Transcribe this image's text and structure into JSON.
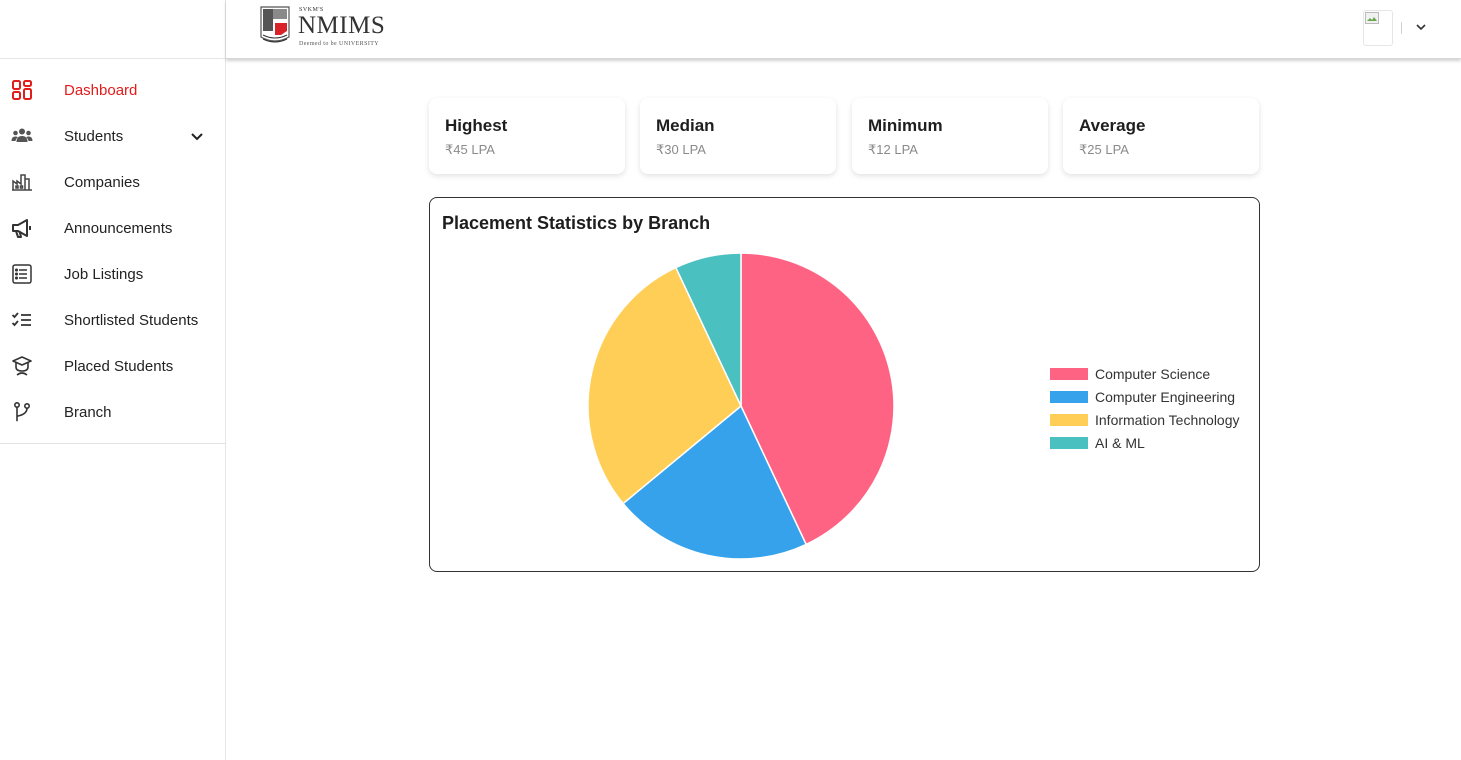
{
  "brand": {
    "small": "SVKM'S",
    "name": "NMIMS",
    "sub": "Deemed to be UNIVERSITY"
  },
  "sidebar": {
    "items": [
      {
        "label": "Dashboard",
        "icon": "dashboard-icon",
        "active": true
      },
      {
        "label": "Students",
        "icon": "users-icon",
        "has_chevron": true
      },
      {
        "label": "Companies",
        "icon": "factory-icon"
      },
      {
        "label": "Announcements",
        "icon": "megaphone-icon"
      },
      {
        "label": "Job Listings",
        "icon": "list-icon"
      },
      {
        "label": "Shortlisted Students",
        "icon": "checklist-icon"
      },
      {
        "label": "Placed Students",
        "icon": "graduate-icon"
      },
      {
        "label": "Branch",
        "icon": "git-branch-icon"
      }
    ]
  },
  "stats": [
    {
      "title": "Highest",
      "value": "₹45 LPA"
    },
    {
      "title": "Median",
      "value": "₹30 LPA"
    },
    {
      "title": "Minimum",
      "value": "₹12 LPA"
    },
    {
      "title": "Average",
      "value": "₹25 LPA"
    }
  ],
  "chart_panel": {
    "title": "Placement Statistics by Branch"
  },
  "chart_data": {
    "type": "pie",
    "title": "Placement Statistics by Branch",
    "categories": [
      "Computer Science",
      "Computer Engineering",
      "Information Technology",
      "AI & ML"
    ],
    "values": [
      43,
      21,
      29,
      7
    ],
    "colors": [
      "#ff6384",
      "#36a2eb",
      "#ffce56",
      "#4bc0c0"
    ],
    "legend_position": "right"
  },
  "colors": {
    "accent": "#e21b1b"
  }
}
